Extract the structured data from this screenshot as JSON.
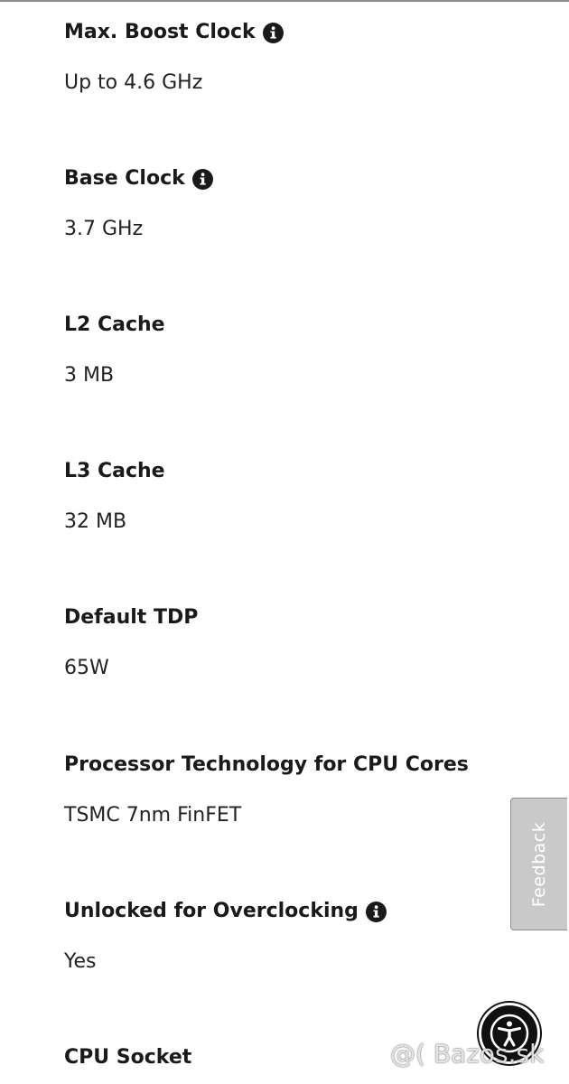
{
  "specs": [
    {
      "label": "Max. Boost Clock",
      "value": "Up to 4.6 GHz",
      "info": true
    },
    {
      "label": "Base Clock",
      "value": "3.7 GHz",
      "info": true
    },
    {
      "label": "L2 Cache",
      "value": "3 MB",
      "info": false
    },
    {
      "label": "L3 Cache",
      "value": "32 MB",
      "info": false
    },
    {
      "label": "Default TDP",
      "value": "65W",
      "info": false
    },
    {
      "label": "Processor Technology for CPU Cores",
      "value": "TSMC 7nm FinFET",
      "info": false
    },
    {
      "label": "Unlocked for Overclocking",
      "value": "Yes",
      "info": true
    },
    {
      "label": "CPU Socket",
      "value": "",
      "info": false
    }
  ],
  "feedback": {
    "label": "Feedback"
  },
  "accessibility": {
    "icon": "accessibility-person-icon"
  },
  "watermark": {
    "text": "@( Bazos.sk"
  },
  "icons": {
    "info": "info-circle-icon"
  },
  "colors": {
    "text": "#1a1a1a",
    "feedback_bg": "#c9c9c9",
    "a11y_bg": "#111111"
  }
}
